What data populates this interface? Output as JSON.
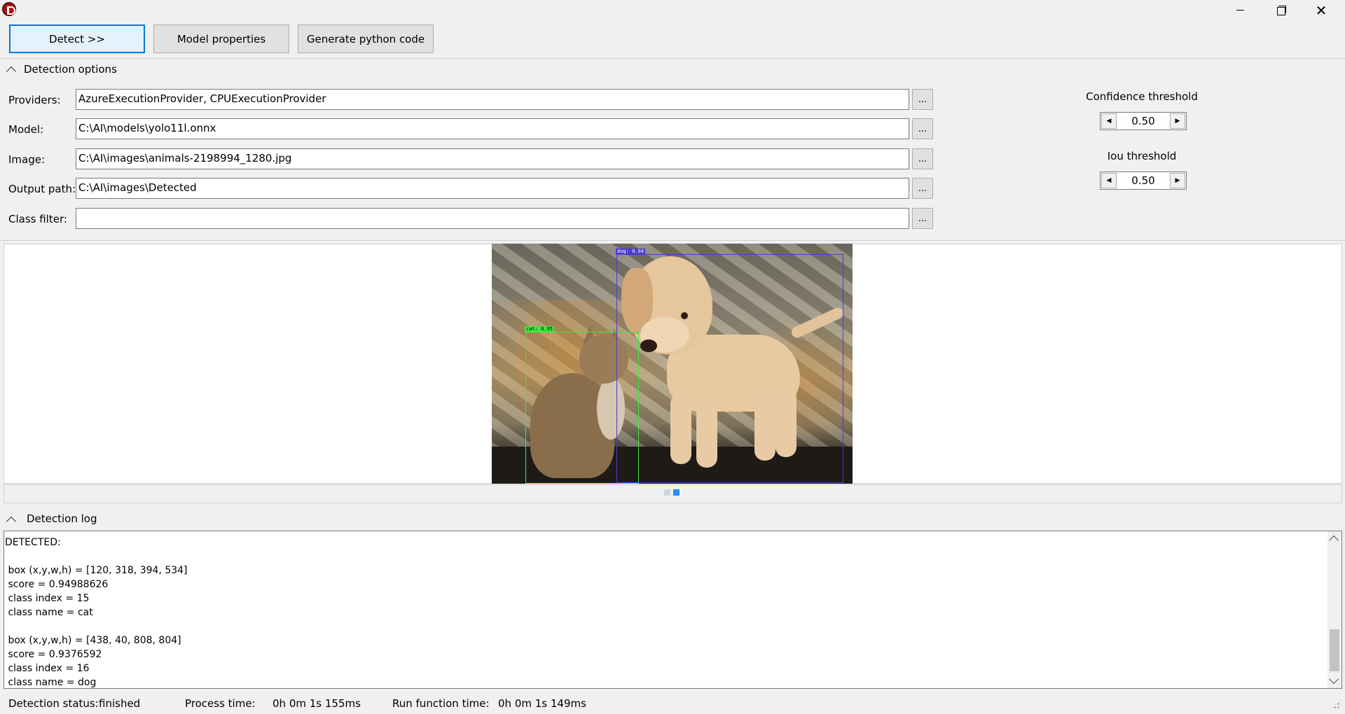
{
  "window": {
    "icon": "app-logo-icon",
    "controls": [
      "minimize-icon",
      "maximize-icon",
      "close-icon"
    ],
    "close_glyph": "✕"
  },
  "toolbar": {
    "detect_label": "Detect >>",
    "model_properties_label": "Model properties",
    "generate_python_label": "Generate python code"
  },
  "detection_options": {
    "title": "Detection options",
    "fields": [
      {
        "label": "Providers:",
        "value": "AzureExecutionProvider, CPUExecutionProvider"
      },
      {
        "label": "Model:",
        "value": "C:\\AI\\models\\yolo11l.onnx"
      },
      {
        "label": "Image:",
        "value": "C:\\AI\\images\\animals-2198994_1280.jpg"
      },
      {
        "label": "Output path:",
        "value": "C:\\AI\\images\\Detected"
      },
      {
        "label": "Class filter:",
        "value": ""
      }
    ],
    "browse_label": "...",
    "confidence": {
      "label": "Confidence threshold",
      "value": "0.50"
    },
    "iou": {
      "label": "Iou threshold",
      "value": "0.50"
    },
    "spin_left": "◀",
    "spin_right": "▶"
  },
  "image_view": {
    "detections": [
      {
        "tag": "cat: 0.95",
        "color": "#3dea3d"
      },
      {
        "tag": "dog: 0.94",
        "color": "#4b3bd6"
      }
    ],
    "pager_active": 2,
    "pager_total": 2
  },
  "detection_log": {
    "title": "Detection log",
    "text": "DETECTED:\n\n box (x,y,w,h) = [120, 318, 394, 534]\n score = 0.94988626\n class index = 15\n class name = cat\n\n box (x,y,w,h) = [438, 40, 808, 804]\n score = 0.9376592\n class index = 16\n class name = dog"
  },
  "status": {
    "detection_status_label": "Detection status:",
    "detection_status_value": "finished",
    "process_time_label": "Process time:",
    "process_time_value": "0h 0m 1s 155ms",
    "run_function_label": "Run function time:",
    "run_function_value": "0h 0m 1s 149ms"
  }
}
